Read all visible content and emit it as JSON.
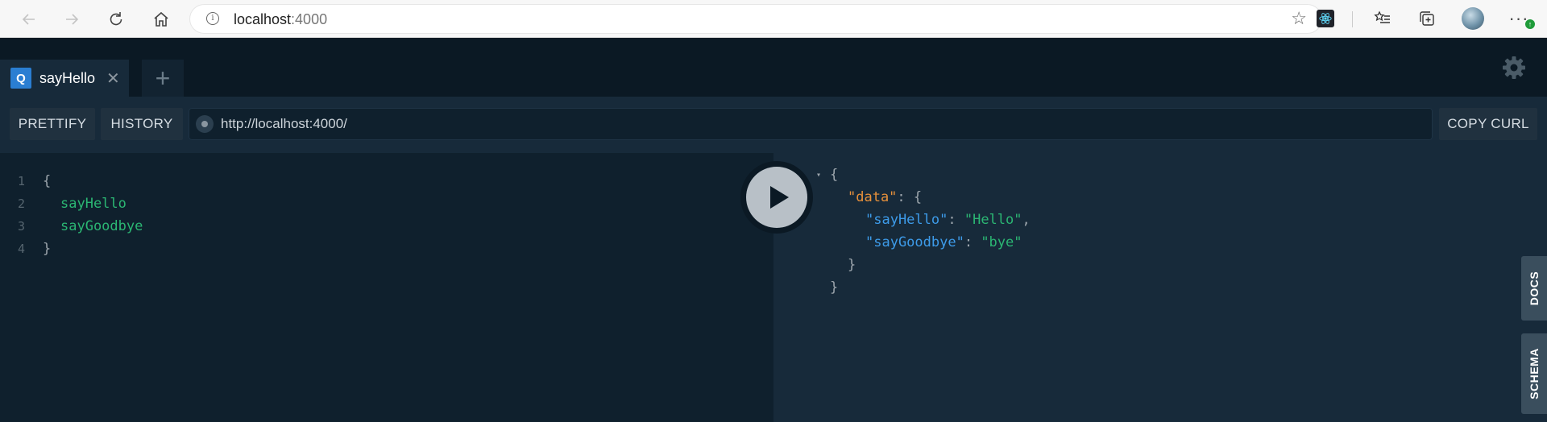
{
  "browser": {
    "address_host": "localhost",
    "address_port": ":4000",
    "more_badge": "↑"
  },
  "tabs": [
    {
      "badge": "Q",
      "label": "sayHello",
      "close": "✕"
    }
  ],
  "new_tab_label": "+",
  "toolbar": {
    "prettify": "PRETTIFY",
    "history": "HISTORY",
    "endpoint": "http://localhost:4000/",
    "copy_curl": "COPY CURL"
  },
  "query_editor": {
    "lines": [
      {
        "num": "1",
        "text": "{"
      },
      {
        "num": "2",
        "text": "sayHello"
      },
      {
        "num": "3",
        "text": "sayGoodbye"
      },
      {
        "num": "4",
        "text": "}"
      }
    ]
  },
  "result": {
    "open_brace": "{",
    "data_key": "\"data\"",
    "data_open": ": {",
    "fields": [
      {
        "key": "\"sayHello\"",
        "value": "\"Hello\"",
        "trail": ","
      },
      {
        "key": "\"sayGoodbye\"",
        "value": "\"bye\"",
        "trail": ""
      }
    ],
    "inner_close": "}",
    "outer_close": "}"
  },
  "side_tabs": {
    "docs": "DOCS",
    "schema": "SCHEMA"
  },
  "colors": {
    "field_green": "#2bb673",
    "key_orange": "#e8913b",
    "key_blue": "#3d9be9",
    "tab_badge_blue": "#2a7ed2"
  },
  "icons": [
    "back-arrow-icon",
    "forward-arrow-icon",
    "reload-icon",
    "home-icon",
    "info-icon",
    "star-icon",
    "react-devtools-icon",
    "favorites-icon",
    "collections-icon",
    "profile-avatar",
    "more-icon",
    "settings-gear-icon",
    "play-icon"
  ]
}
